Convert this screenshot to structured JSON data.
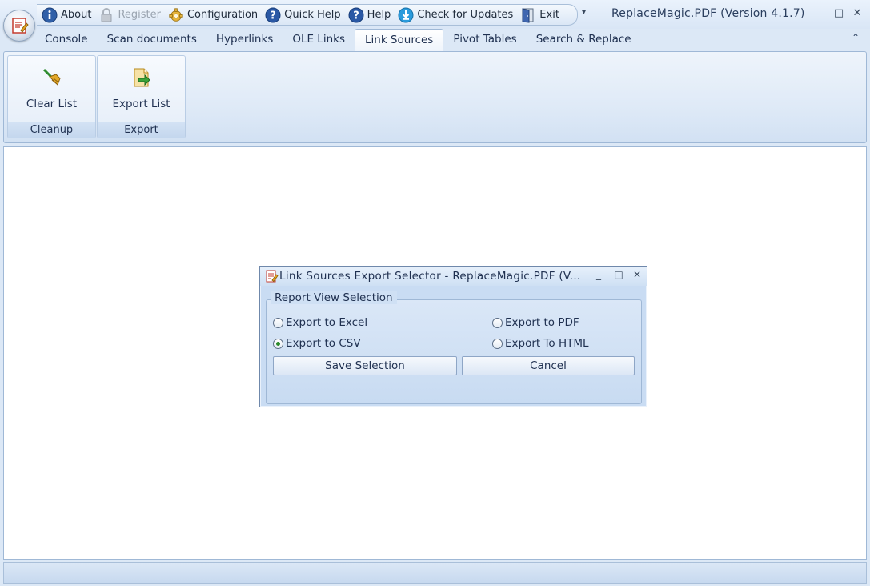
{
  "window": {
    "title": "ReplaceMagic.PDF (Version 4.1.7)",
    "minimize": "_",
    "maximize": "□",
    "close": "✕"
  },
  "quick_access": [
    {
      "label": "About",
      "icon": "info-icon",
      "enabled": true
    },
    {
      "label": "Register",
      "icon": "lock-icon",
      "enabled": false
    },
    {
      "label": "Configuration",
      "icon": "gear-icon",
      "enabled": true
    },
    {
      "label": "Quick Help",
      "icon": "help-icon",
      "enabled": true
    },
    {
      "label": "Help",
      "icon": "help-icon",
      "enabled": true
    },
    {
      "label": "Check for Updates",
      "icon": "download-icon",
      "enabled": true
    },
    {
      "label": "Exit",
      "icon": "exit-door-icon",
      "enabled": true
    }
  ],
  "qat_customize": "▾",
  "tabs": [
    {
      "label": "Console",
      "active": false
    },
    {
      "label": "Scan documents",
      "active": false
    },
    {
      "label": "Hyperlinks",
      "active": false
    },
    {
      "label": "OLE Links",
      "active": false
    },
    {
      "label": "Link Sources",
      "active": true
    },
    {
      "label": "Pivot Tables",
      "active": false
    },
    {
      "label": "Search & Replace",
      "active": false
    }
  ],
  "ribbon_collapse": "⌃",
  "ribbon_groups": [
    {
      "name": "Cleanup",
      "button": "Clear List",
      "icon": "broom-icon"
    },
    {
      "name": "Export",
      "button": "Export List",
      "icon": "export-icon"
    }
  ],
  "dialog": {
    "title": "Link Sources  Export  Selector  -  ReplaceMagic.PDF  (V...",
    "minimize": "_",
    "maximize": "□",
    "close": "✕",
    "group_label": "Report View Selection",
    "options": [
      {
        "label": "Export to Excel",
        "selected": false
      },
      {
        "label": "Export to PDF",
        "selected": false
      },
      {
        "label": "Export to CSV",
        "selected": true
      },
      {
        "label": "Export To HTML",
        "selected": false
      }
    ],
    "save_label": "Save Selection",
    "cancel_label": "Cancel"
  },
  "statusbar": {
    "grip": "......"
  },
  "colors": {
    "accent": "#2b6cc4",
    "frame": "#dce8f6",
    "content_bg": "#ffffff",
    "radio_selected": "#2b8a2b"
  }
}
